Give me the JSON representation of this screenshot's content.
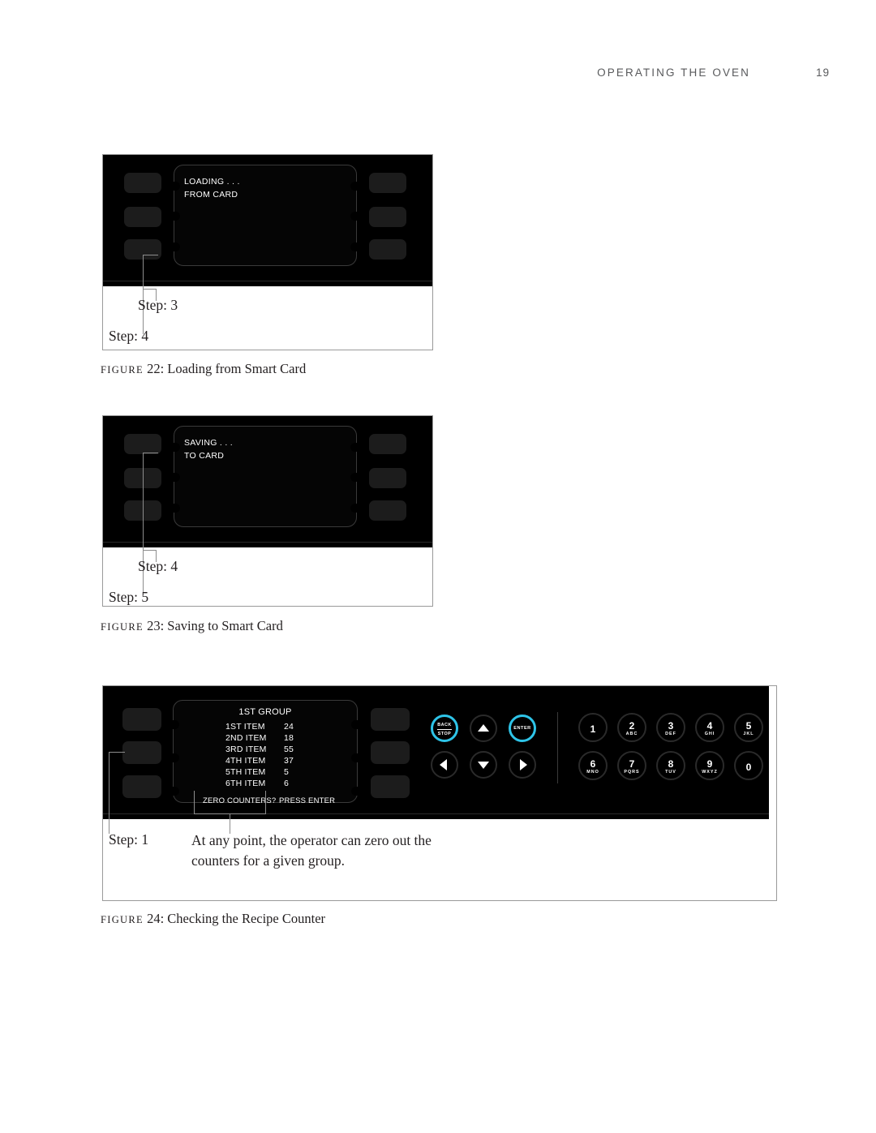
{
  "header": {
    "title": "OPERATING THE OVEN",
    "page_number": "19"
  },
  "colors": {
    "accent": "#2ec4e8",
    "panel": "#000000",
    "softkey": "#1c1c1c",
    "text": "#231f20",
    "header_text": "#58595b",
    "leader": "#8d8d8d"
  },
  "figure22": {
    "caption_prefix": "FIGURE",
    "caption_number": "22:",
    "caption_text": "Loading from Smart Card",
    "display": {
      "line1": "LOADING . . .",
      "line2": "FROM CARD"
    },
    "callouts": [
      {
        "label": "Step: 3"
      },
      {
        "label": "Step: 4"
      }
    ]
  },
  "figure23": {
    "caption_prefix": "FIGURE",
    "caption_number": "23:",
    "caption_text": "Saving to Smart Card",
    "display": {
      "line1": "SAVING . . .",
      "line2": "TO CARD"
    },
    "callouts": [
      {
        "label": "Step: 4"
      },
      {
        "label": "Step: 5"
      }
    ]
  },
  "figure24": {
    "caption_prefix": "FIGURE",
    "caption_number": "24:",
    "caption_text": "Checking the Recipe Counter",
    "display": {
      "title": "1ST GROUP",
      "rows": [
        {
          "label": "1ST ITEM",
          "value": "24"
        },
        {
          "label": "2ND ITEM",
          "value": "18"
        },
        {
          "label": "3RD ITEM",
          "value": "55"
        },
        {
          "label": "4TH ITEM",
          "value": "37"
        },
        {
          "label": "5TH ITEM",
          "value": "5"
        },
        {
          "label": "6TH ITEM",
          "value": "6"
        }
      ],
      "footer_left": "ZERO COUNTERS?",
      "footer_right": "PRESS ENTER"
    },
    "nav": {
      "back": "BACK",
      "stop": "STOP",
      "enter": "ENTER",
      "up_icon": "arrow-up-icon",
      "down_icon": "arrow-down-icon",
      "left_icon": "arrow-left-icon",
      "right_icon": "arrow-right-icon"
    },
    "keypad": [
      {
        "num": "1",
        "letters": ""
      },
      {
        "num": "2",
        "letters": "ABC"
      },
      {
        "num": "3",
        "letters": "DEF"
      },
      {
        "num": "4",
        "letters": "GHI"
      },
      {
        "num": "5",
        "letters": "JKL"
      },
      {
        "num": "6",
        "letters": "MNO"
      },
      {
        "num": "7",
        "letters": "PQRS"
      },
      {
        "num": "8",
        "letters": "TUV"
      },
      {
        "num": "9",
        "letters": "WXYZ"
      },
      {
        "num": "0",
        "letters": ""
      }
    ],
    "callouts": [
      {
        "label": "Step: 1"
      }
    ],
    "note": "At any point, the operator can zero out the counters for a given group."
  }
}
